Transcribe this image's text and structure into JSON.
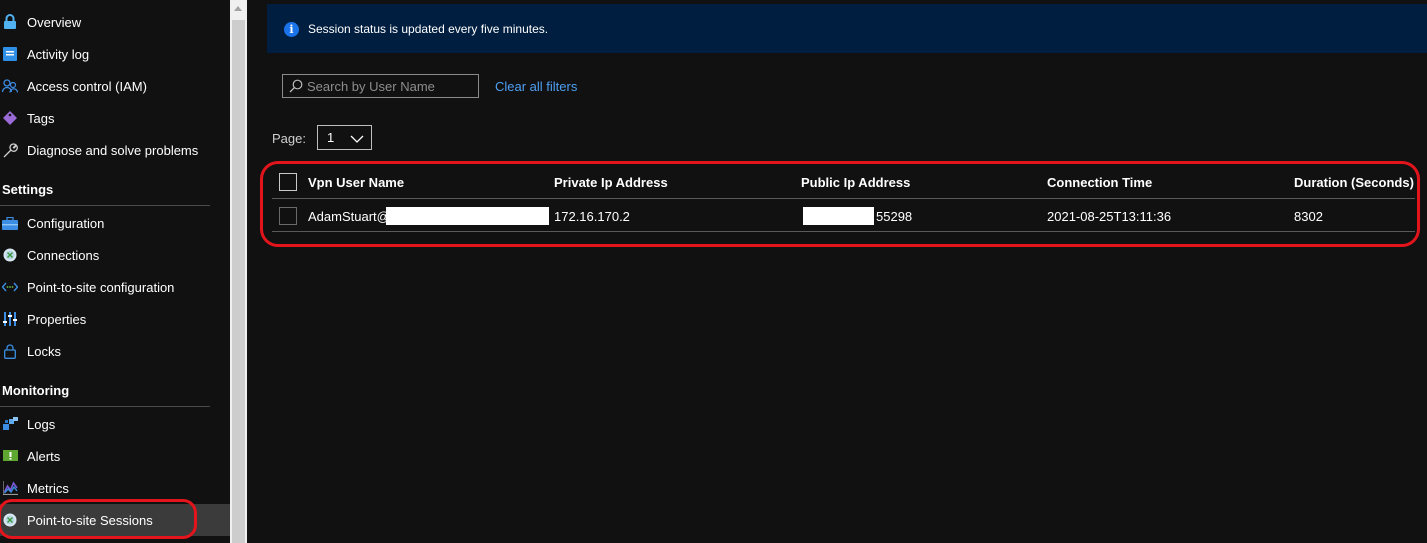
{
  "sidebar": {
    "items_top": [
      {
        "label": "Overview",
        "icon": "lock-shield-icon"
      },
      {
        "label": "Activity log",
        "icon": "activity-log-icon"
      },
      {
        "label": "Access control (IAM)",
        "icon": "people-icon"
      },
      {
        "label": "Tags",
        "icon": "tag-icon"
      },
      {
        "label": "Diagnose and solve problems",
        "icon": "wrench-icon"
      }
    ],
    "settings_header": "Settings",
    "settings_items": [
      {
        "label": "Configuration",
        "icon": "toolbox-icon"
      },
      {
        "label": "Connections",
        "icon": "connection-icon"
      },
      {
        "label": "Point-to-site configuration",
        "icon": "code-arrows-icon"
      },
      {
        "label": "Properties",
        "icon": "sliders-icon"
      },
      {
        "label": "Locks",
        "icon": "lock-icon"
      }
    ],
    "monitoring_header": "Monitoring",
    "monitoring_items": [
      {
        "label": "Logs",
        "icon": "logs-icon"
      },
      {
        "label": "Alerts",
        "icon": "alert-icon"
      },
      {
        "label": "Metrics",
        "icon": "metrics-icon"
      },
      {
        "label": "Point-to-site Sessions",
        "icon": "connection-icon",
        "selected": true
      }
    ]
  },
  "banner": {
    "text": "Session status is updated every five minutes."
  },
  "search": {
    "placeholder": "Search by User Name",
    "value": ""
  },
  "clear_filters_label": "Clear all filters",
  "pagination": {
    "label": "Page:",
    "value": "1"
  },
  "table": {
    "columns": [
      "Vpn User Name",
      "Private Ip Address",
      "Public Ip Address",
      "Connection Time",
      "Duration (Seconds)"
    ],
    "rows": [
      {
        "user": "AdamStuart@",
        "private_ip": "172.16.170.2",
        "public_ip": "55298",
        "connection_time": "2021-08-25T13:11:36",
        "duration": "8302"
      }
    ]
  },
  "colors": {
    "highlight": "#e3141b",
    "link": "#4f9ff2",
    "banner_bg": "#001e3f",
    "info_icon": "#1a73e8"
  }
}
